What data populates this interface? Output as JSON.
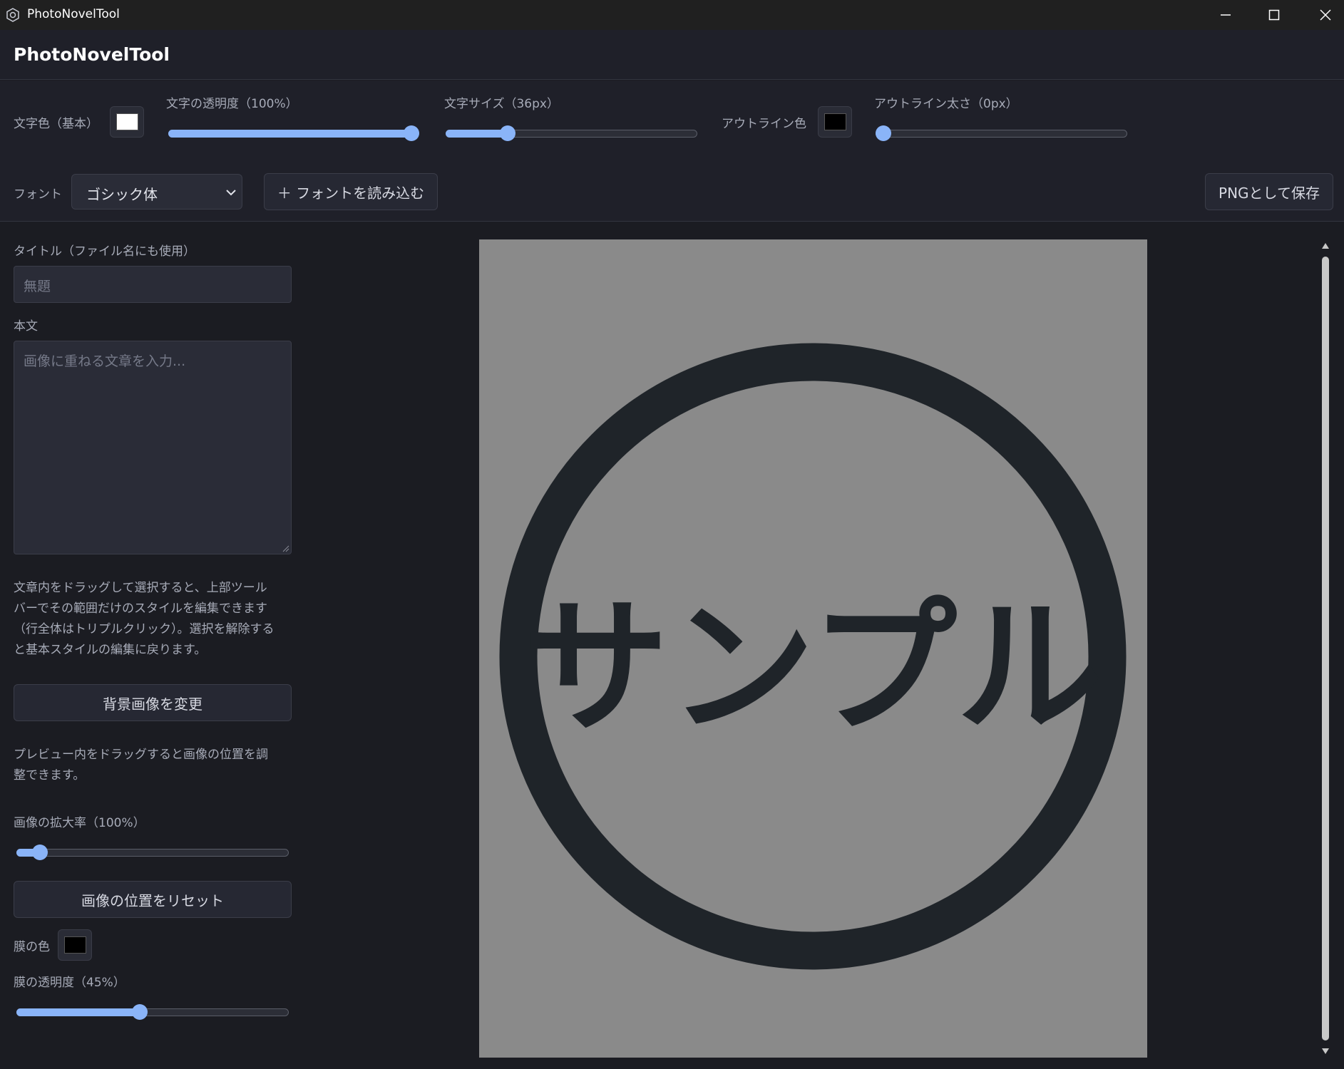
{
  "window": {
    "title": "PhotoNovelTool",
    "controls": [
      "minimize-icon",
      "maximize-icon",
      "close-icon"
    ]
  },
  "header": {
    "app_title": "PhotoNovelTool"
  },
  "toolbar": {
    "text_color_label": "文字色（基本）",
    "text_color": "#ffffff",
    "text_opacity_label": "文字の透明度（100%）",
    "text_opacity": 100,
    "text_size_label": "文字サイズ（36px）",
    "text_size_fraction": 0.23,
    "outline_color_label": "アウトライン色",
    "outline_color": "#000000",
    "outline_width_label": "アウトライン太さ（0px）",
    "outline_width": 0,
    "font_label": "フォント",
    "font_selected": "ゴシック体",
    "load_font_button": "＋ フォントを読み込む",
    "save_png_button": "PNGとして保存"
  },
  "left_panel": {
    "title_label": "タイトル（ファイル名にも使用）",
    "title_placeholder": "無題",
    "body_label": "本文",
    "body_placeholder": "画像に重ねる文章を入力...",
    "help_text_1_lines": [
      "文章内をドラッグして選択すると、上部ツール",
      "バーでその範囲だけのスタイルを編集できます",
      "（行全体はトリプルクリック）。選択を解除する",
      "と基本スタイルの編集に戻ります。"
    ],
    "change_bg_button": "背景画像を変更",
    "help_text_2_lines": [
      "プレビュー内をドラッグすると画像の位置を調",
      "整できます。"
    ],
    "zoom_label": "画像の拡大率（100%）",
    "zoom_fraction": 0.06,
    "reset_position_button": "画像の位置をリセット",
    "film_color_label": "膜の色",
    "film_color": "#000000",
    "film_opacity_label": "膜の透明度（45%）",
    "film_opacity": 45
  },
  "preview": {
    "image_text": "サンプル",
    "background": "#8a8a8a",
    "ink": "#1f2429"
  },
  "colors": {
    "accent": "#8ab4f8"
  }
}
